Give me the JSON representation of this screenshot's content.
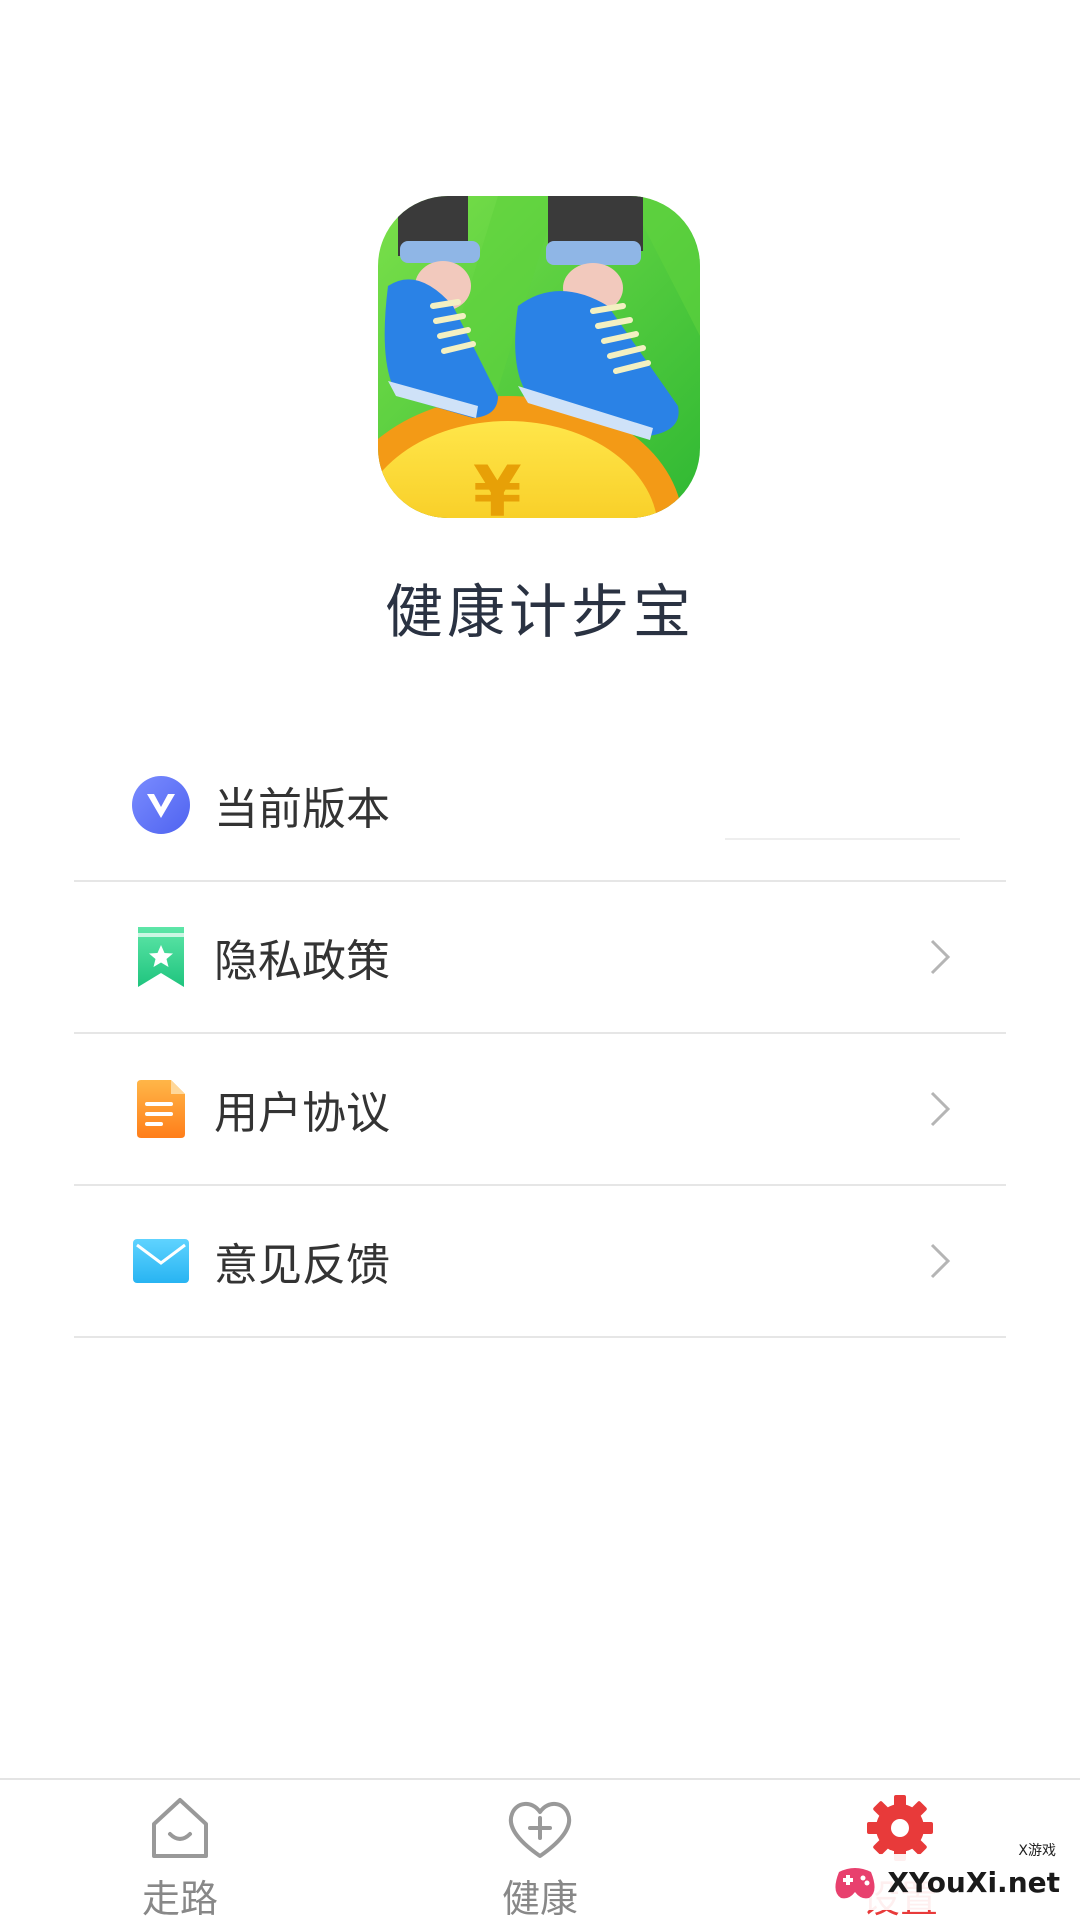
{
  "app": {
    "name": "健康计步宝",
    "logo_icon": "running-shoes-coin-logo"
  },
  "settings": {
    "items": [
      {
        "label": "当前版本",
        "icon": "version-v-icon",
        "value": ""
      },
      {
        "label": "隐私政策",
        "icon": "bookmark-star-icon"
      },
      {
        "label": "用户协议",
        "icon": "document-icon"
      },
      {
        "label": "意见反馈",
        "icon": "mail-icon"
      }
    ]
  },
  "tabbar": {
    "tabs": [
      {
        "label": "走路",
        "icon": "home-smile-icon",
        "active": false
      },
      {
        "label": "健康",
        "icon": "heart-plus-icon",
        "active": false
      },
      {
        "label": "设置",
        "icon": "gear-icon",
        "active": true
      }
    ]
  },
  "watermark": {
    "text": "XYouXi.net",
    "small": "X游戏"
  },
  "colors": {
    "accent": "#e83a3a",
    "text": "#333333",
    "title": "#2a3242",
    "divider": "#e6e6e6"
  }
}
